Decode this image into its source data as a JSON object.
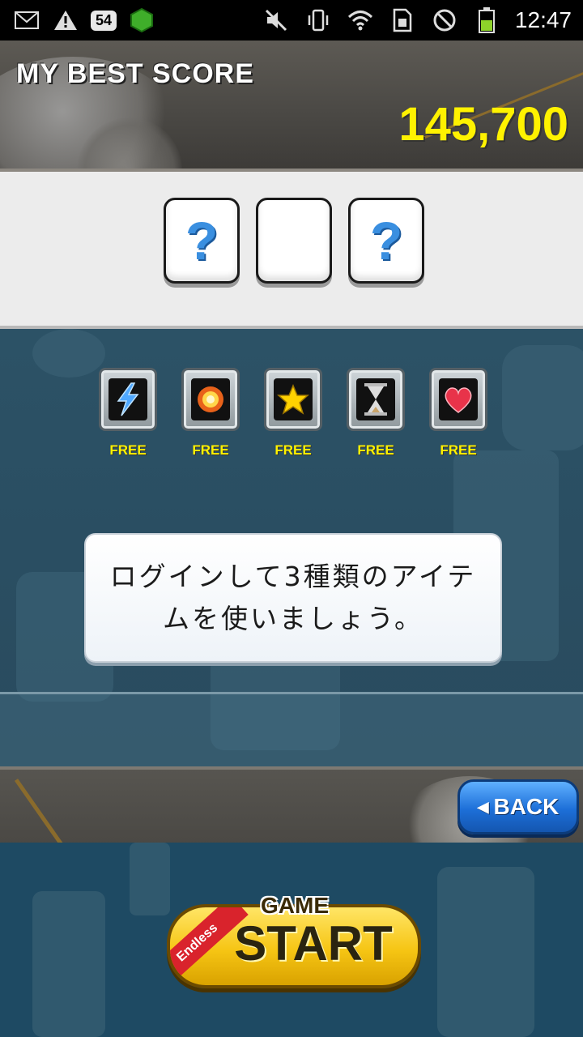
{
  "status_bar": {
    "notification_count": "54",
    "time": "12:47",
    "icons": [
      "gmail-icon",
      "warning-icon",
      "notification-badge-icon",
      "app-icon",
      "mute-icon",
      "vibrate-icon",
      "wifi-icon",
      "sim-icon",
      "no-signal-icon",
      "battery-icon"
    ]
  },
  "header": {
    "best_score_label": "MY BEST SCORE",
    "best_score_value": "145,700"
  },
  "slots": [
    {
      "symbol": "?"
    },
    {
      "symbol": ""
    },
    {
      "symbol": "?"
    }
  ],
  "items": [
    {
      "icon": "lightning-icon",
      "label": "FREE"
    },
    {
      "icon": "explosion-icon",
      "label": "FREE"
    },
    {
      "icon": "star-icon",
      "label": "FREE"
    },
    {
      "icon": "hourglass-icon",
      "label": "FREE"
    },
    {
      "icon": "heart-icon",
      "label": "FREE"
    }
  ],
  "message": {
    "line1": "ログインして3種類のアイテ",
    "line2": "ムを使いましょう。"
  },
  "buttons": {
    "back_label": "BACK",
    "start_game_label": "GAME",
    "start_label": "START",
    "endless_label": "Endless"
  },
  "colors": {
    "score_yellow": "#fff200",
    "back_blue": "#1d6fd8",
    "start_gold": "#f6c514",
    "ribbon_red": "#d9232c"
  }
}
